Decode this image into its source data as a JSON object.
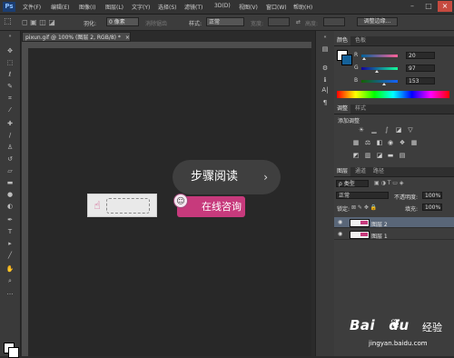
{
  "menubar": {
    "logo": "Ps",
    "items": [
      "文件(F)",
      "编辑(E)",
      "图像(I)",
      "图层(L)",
      "文字(Y)",
      "选择(S)",
      "滤镜(T)",
      "3D(D)",
      "视图(V)",
      "窗口(W)",
      "帮助(H)"
    ],
    "window_controls": {
      "minimize": "–",
      "maximize": "□",
      "close": "×"
    }
  },
  "options": {
    "feather_label": "羽化:",
    "feather_value": "0 像素",
    "antialias_label": "消除锯齿",
    "style_label": "样式:",
    "style_value": "正常",
    "width_label": "宽度:",
    "height_label": "高度:",
    "refine_edge": "调整边缘..."
  },
  "document": {
    "tab_title": "pixun.gif @ 100% (图层 2, RGB/8) *",
    "tab_close": "×",
    "banner_text": "在线咨询"
  },
  "overlay": {
    "label": "步骤阅读",
    "chevron": "›"
  },
  "color_panel": {
    "tabs": [
      "颜色",
      "色板"
    ],
    "channels": [
      {
        "name": "R",
        "value": "20"
      },
      {
        "name": "G",
        "value": "97"
      },
      {
        "name": "B",
        "value": "153"
      }
    ],
    "foreground_hex": "#146199"
  },
  "adjustments_panel": {
    "tabs": [
      "调整",
      "样式"
    ],
    "title": "添加调整"
  },
  "layers_panel": {
    "tabs": [
      "图层",
      "通道",
      "路径"
    ],
    "kind_label": "ρ 类型",
    "blend_mode": "正常",
    "opacity_label": "不透明度:",
    "opacity_value": "100%",
    "lock_label": "锁定:",
    "fill_label": "填充:",
    "fill_value": "100%",
    "layers": [
      {
        "name": "图层 2",
        "selected": true
      },
      {
        "name": "图层 1",
        "selected": false
      }
    ]
  },
  "watermark": {
    "brand": "Bai",
    "brand_suffix": "du",
    "service": "经验",
    "domain": "jingyan.baidu.com"
  }
}
